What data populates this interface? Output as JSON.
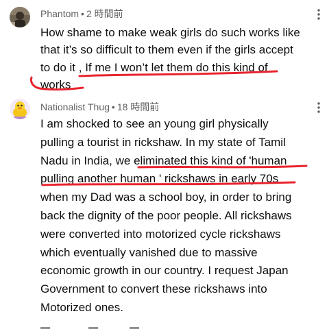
{
  "comments": [
    {
      "author": "Phantom",
      "time": "2 時間前",
      "avatar_icon": "profile-photo-icon",
      "lines": [
        "How shame to make weak girls do such works like",
        "that it’s so difficult to them even if the girls accept",
        "to do it , If me I won’t let them do this kind of",
        "works"
      ]
    },
    {
      "author": "Nationalist Thug",
      "time": "18 時間前",
      "avatar_icon": "duck-avatar-icon",
      "lines": [
        "I am shocked to see an young girl physically",
        "pulling a tourist in rickshaw. In my state of Tamil",
        "Nadu in India,  we eliminated this kind of 'human",
        "pulling another human ' rickshaws in early 70s",
        "when my Dad was a school boy,  in order to bring",
        "back the  dignity of the poor people. All rickshaws",
        "were converted into motorized cycle rickshaws",
        "which eventually vanished due to massive",
        "economic growth in our country. I request Japan",
        "Government to convert these rickshaws into",
        "Motorized ones."
      ]
    }
  ],
  "separator": "•",
  "kebab_icon": "more-vert-icon",
  "annotation_color": "#e8242e"
}
